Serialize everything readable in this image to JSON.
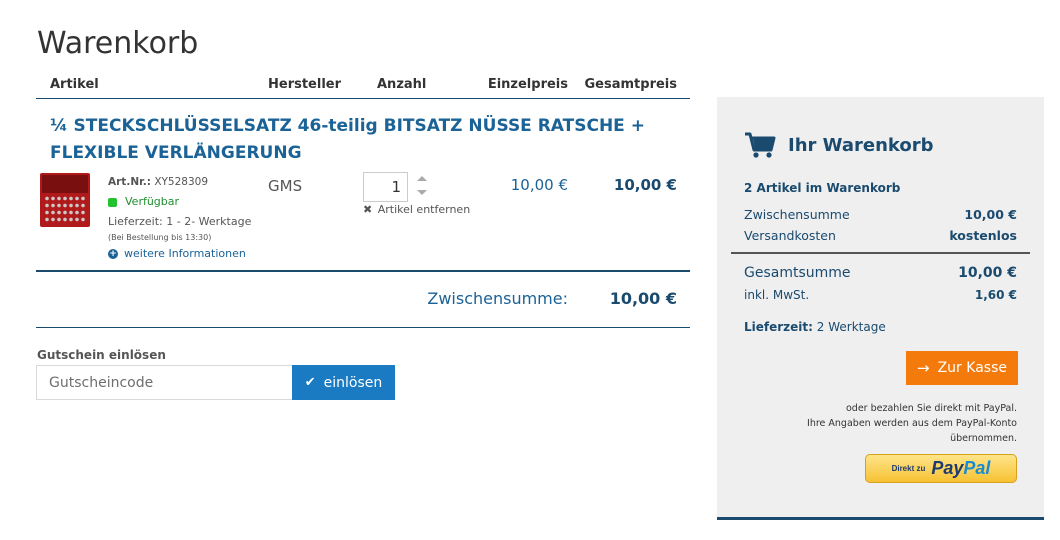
{
  "page": {
    "title": "Warenkorb"
  },
  "table_header": {
    "artikel": "Artikel",
    "hersteller": "Hersteller",
    "anzahl": "Anzahl",
    "einzelpreis": "Einzelpreis",
    "gesamtpreis": "Gesamtpreis"
  },
  "item": {
    "title": "¼ STECKSCHLÜSSELSATZ 46-teilig BITSATZ NÜSSE RATSCHE + FLEXIBLE VERLÄNGERUNG",
    "art_nr_label": "Art.Nr.:",
    "art_nr": "XY528309",
    "availability": "Verfügbar",
    "lieferzeit": "Lieferzeit: 1 - 2- Werktage",
    "order_note": "(Bei Bestellung bis 13:30)",
    "more_info": "weitere Informationen",
    "manufacturer": "GMS",
    "quantity": "1",
    "remove_label": "Artikel entfernen",
    "unit_price": "10,00 €",
    "total_price": "10,00 €"
  },
  "subtotal": {
    "label": "Zwischensumme:",
    "value": "10,00 €"
  },
  "coupon": {
    "label": "Gutschein einlösen",
    "placeholder": "Gutscheincode",
    "button": "einlösen"
  },
  "summary": {
    "title": "Ihr Warenkorb",
    "count": "2 Artikel im Warenkorb",
    "zwischensumme_label": "Zwischensumme",
    "zwischensumme_value": "10,00 €",
    "versand_label": "Versandkosten",
    "versand_value": "kostenlos",
    "gesamt_label": "Gesamtsumme",
    "gesamt_value": "10,00 €",
    "mwst_label": "inkl. MwSt.",
    "mwst_value": "1,60 €",
    "lieferzeit_label": "Lieferzeit:",
    "lieferzeit_value": "2 Werktage",
    "checkout_button": "Zur Kasse",
    "paypal_note_1": "oder bezahlen Sie direkt mit PayPal.",
    "paypal_note_2": "Ihre Angaben werden aus dem PayPal-Konto übernommen.",
    "paypal_pre": "Direkt zu",
    "paypal_pay": "Pay",
    "paypal_pal": "Pal"
  },
  "icons": {
    "cart": "shopping-cart-icon",
    "remove": "close-icon",
    "info": "plus-circle-icon",
    "check": "check-icon",
    "arrow": "arrow-right-icon"
  },
  "colors": {
    "primary_blue": "#1b6296",
    "dark_blue": "#1a4a6e",
    "button_blue": "#1b7bc2",
    "checkout_orange": "#f47b0b",
    "available_green": "#22c32f",
    "summary_bg": "#efefef"
  }
}
